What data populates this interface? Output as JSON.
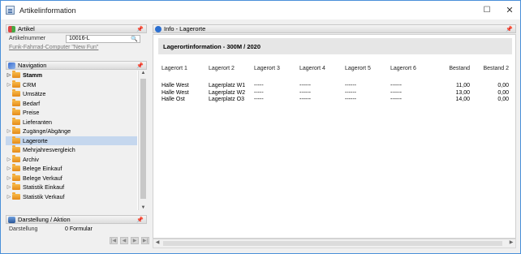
{
  "window": {
    "title": "Artikelinformation"
  },
  "artikel": {
    "header": "Artikel",
    "label": "Artikelnummer",
    "value": "10016-L",
    "description": "Funk-Fahrrad-Computer \"New Fun\""
  },
  "navigation": {
    "header": "Navigation",
    "items": [
      {
        "label": "Stamm",
        "expandable": true,
        "bold": true
      },
      {
        "label": "CRM",
        "expandable": true
      },
      {
        "label": "Umsätze",
        "expandable": false
      },
      {
        "label": "Bedarf",
        "expandable": false
      },
      {
        "label": "Preise",
        "expandable": false
      },
      {
        "label": "Lieferanten",
        "expandable": false
      },
      {
        "label": "Zugänge/Abgänge",
        "expandable": true
      },
      {
        "label": "Lagerorte",
        "expandable": false,
        "selected": true
      },
      {
        "label": "Mehrjahresvergleich",
        "expandable": false
      },
      {
        "label": "Archiv",
        "expandable": true
      },
      {
        "label": "Belege Einkauf",
        "expandable": true
      },
      {
        "label": "Belege Verkauf",
        "expandable": true
      },
      {
        "label": "Statistik Einkauf",
        "expandable": true
      },
      {
        "label": "Statistik Verkauf",
        "expandable": true
      }
    ]
  },
  "darstellung": {
    "header": "Darstellung / Aktion",
    "label": "Darstellung",
    "value": "0 Formular"
  },
  "info": {
    "header": "Info - Lagerorte",
    "title": "Lagerortinformation - 300M / 2020",
    "columns": [
      "Lagerort 1",
      "Lagerort 2",
      "Lagerort 3",
      "Lagerort 4",
      "Lagerort 5",
      "Lagerort 6",
      "Bestand",
      "Bestand 2"
    ],
    "rows": [
      [
        "Halle West",
        "Lagerplatz W1",
        "-----",
        "------",
        "------",
        "------",
        "11,00",
        "0,00"
      ],
      [
        "Halle West",
        "Lagerplatz W2",
        "-----",
        "------",
        "------",
        "------",
        "13,00",
        "0,00"
      ],
      [
        "Halle Ost",
        "Lagerplatz O3",
        "-----",
        "------",
        "------",
        "------",
        "14,00",
        "0,00"
      ]
    ]
  },
  "colors": {
    "selection": "#c5d7ee",
    "folder": "#f2a93b",
    "pin": "#c0392b",
    "accent": "#4a90d9"
  }
}
